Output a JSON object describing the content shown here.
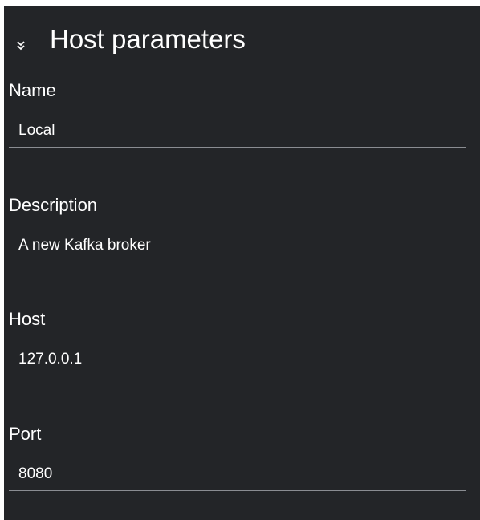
{
  "section": {
    "title": "Host parameters",
    "collapse_icon": "double-chevron-down-icon"
  },
  "fields": {
    "name": {
      "label": "Name",
      "value": "Local"
    },
    "description": {
      "label": "Description",
      "value": "A new Kafka broker"
    },
    "host": {
      "label": "Host",
      "value": "127.0.0.1"
    },
    "port": {
      "label": "Port",
      "value": "8080"
    }
  },
  "colors": {
    "panel_background": "#232528",
    "text": "#ffffff",
    "underline": "#8a8d92"
  }
}
